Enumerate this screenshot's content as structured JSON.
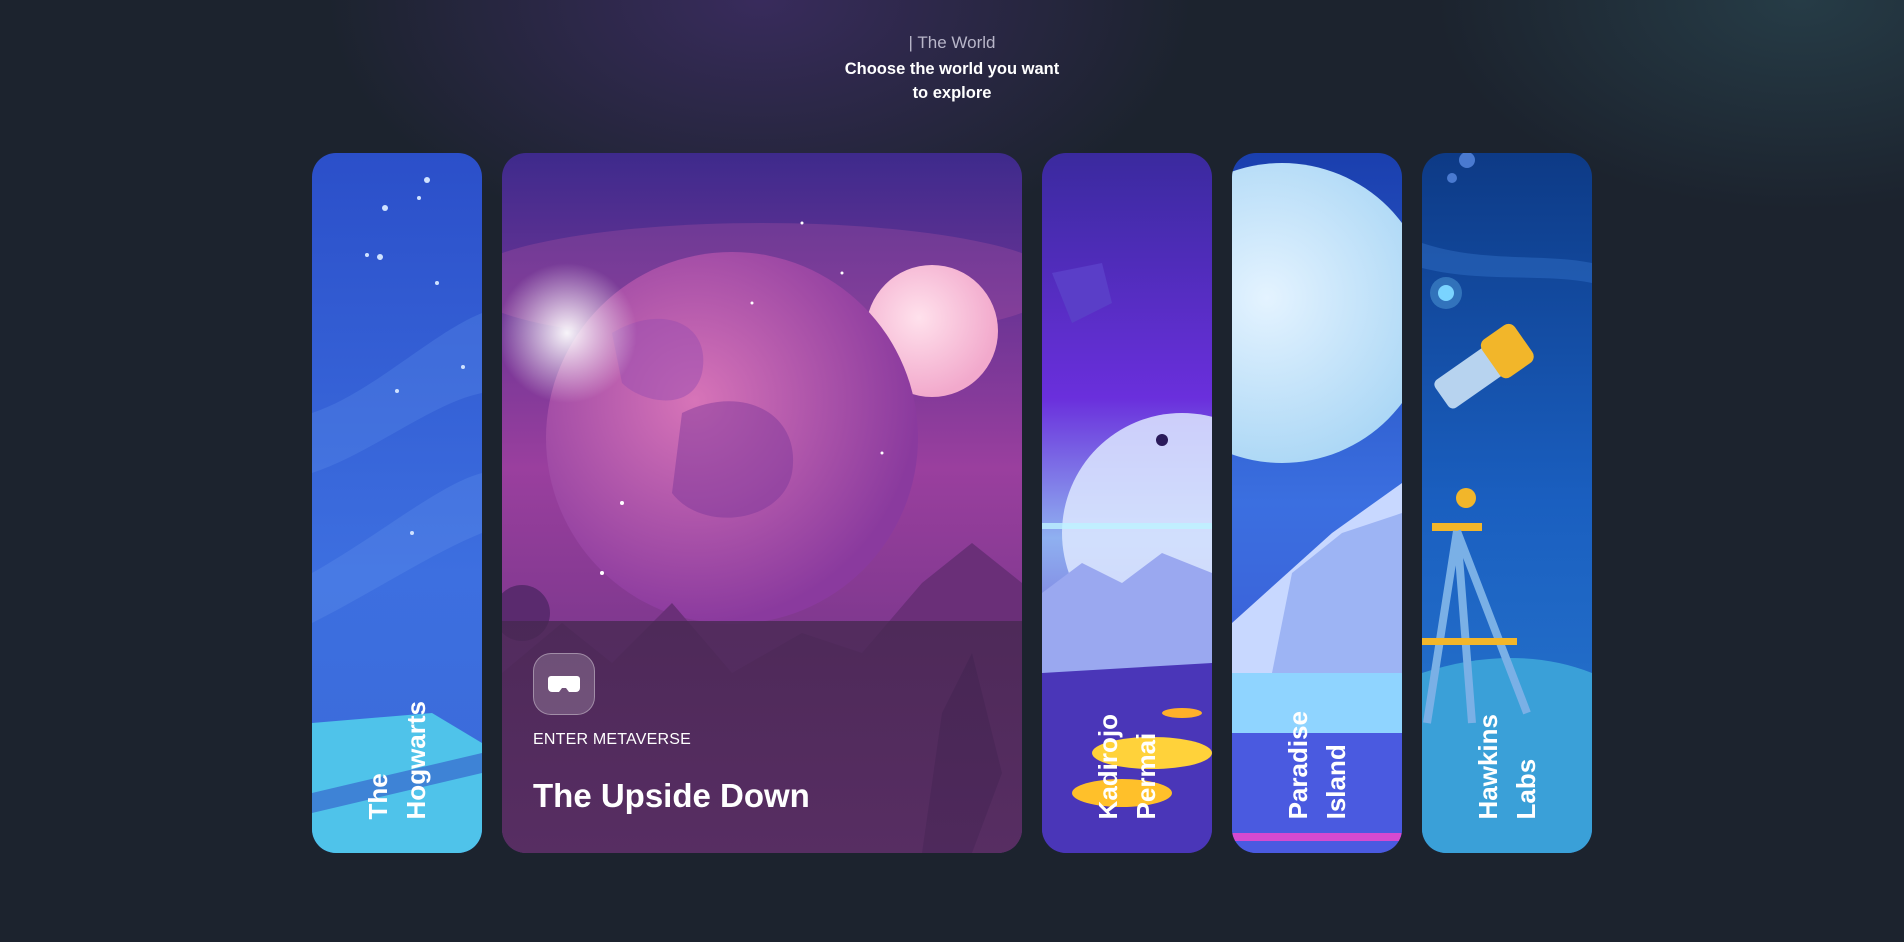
{
  "header": {
    "eyebrow": "| The World",
    "headline": "Choose the world you want to explore"
  },
  "cards": [
    {
      "label": "The\nHogwarts"
    },
    {
      "cta": "ENTER METAVERSE",
      "title": "The Upside Down",
      "icon": "vr-headset-icon"
    },
    {
      "label": "Kadirojo\nPermai"
    },
    {
      "label": "Paradise\nIsland"
    },
    {
      "label": "Hawkins\nLabs"
    }
  ],
  "colors": {
    "background": "#1c232e",
    "hogwarts": "#3a63d6",
    "upside_down": "#8a3fa8",
    "kadirojo": "#5b2fd8",
    "paradise": "#3b6fe0",
    "hawkins": "#1a5fc0"
  }
}
